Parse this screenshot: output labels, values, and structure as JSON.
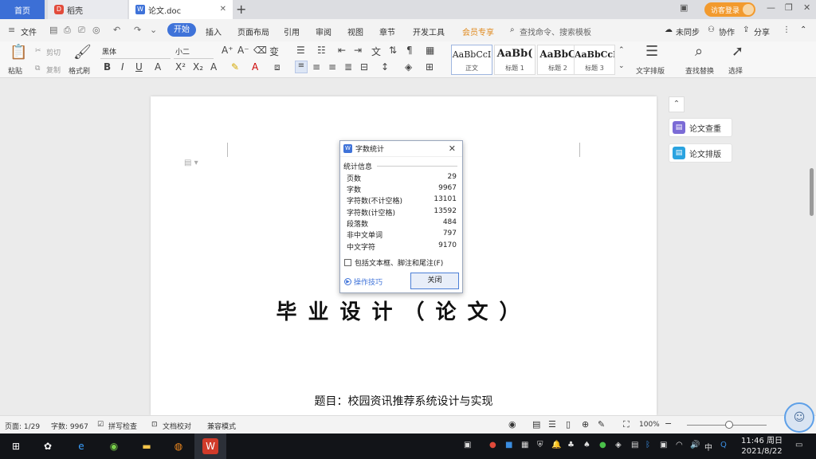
{
  "tabs": {
    "home": "首页",
    "shell": "稻壳",
    "doc": "论文.doc",
    "new": "+"
  },
  "account": {
    "guest_login": "访客登录"
  },
  "menu": {
    "file": "文件",
    "start": "开始",
    "items": [
      "插入",
      "页面布局",
      "引用",
      "审阅",
      "视图",
      "章节",
      "开发工具",
      "会员专享"
    ],
    "search": "查找命令、搜索模板",
    "sync": "未同步",
    "collab": "协作",
    "share": "分享"
  },
  "ribbon": {
    "paste": "粘贴",
    "cut": "剪切",
    "copy": "复制",
    "format_painter": "格式刷",
    "font_family": "黑体",
    "font_size": "小二",
    "styles": [
      {
        "preview": "AaBbCcI",
        "name": "正文"
      },
      {
        "preview": "AaBb(",
        "name": "标题 1"
      },
      {
        "preview": "AaBbC",
        "name": "标题 2"
      },
      {
        "preview": "AaBbCcI",
        "name": "标题 3"
      }
    ],
    "text_layout": "文字排版",
    "find_replace": "查找替换",
    "select": "选择"
  },
  "document": {
    "title": "毕业设计（论文）",
    "topic": "题目：校园资讯推荐系统设计与实现"
  },
  "side_panel": {
    "check": "论文查重",
    "layout": "论文排版"
  },
  "dialog": {
    "title": "字数统计",
    "section": "统计信息",
    "stats": [
      {
        "label": "页数",
        "value": "29"
      },
      {
        "label": "字数",
        "value": "9967"
      },
      {
        "label": "字符数(不计空格)",
        "value": "13101"
      },
      {
        "label": "字符数(计空格)",
        "value": "13592"
      },
      {
        "label": "段落数",
        "value": "484"
      },
      {
        "label": "非中文单词",
        "value": "797"
      },
      {
        "label": "中文字符",
        "value": "9170"
      }
    ],
    "checkbox": "包括文本框、脚注和尾注(F)",
    "tips": "操作技巧",
    "close": "关闭"
  },
  "status": {
    "page": "页面: 1/29",
    "words": "字数: 9967",
    "spell": "拼写检查",
    "proof": "文档校对",
    "compat": "兼容模式",
    "zoom": "100%"
  },
  "taskbar": {
    "time": "11:46 周日",
    "date": "2021/8/22",
    "ime": "中"
  }
}
